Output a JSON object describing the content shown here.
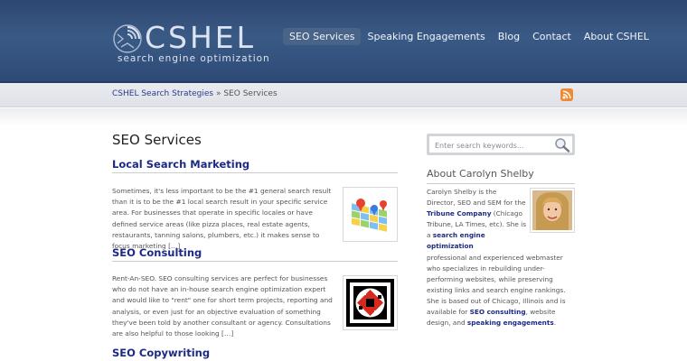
{
  "header": {
    "logo_text": "CSHEL",
    "logo_tagline": "search engine optimization",
    "nav": [
      {
        "label": "SEO Services",
        "active": true
      },
      {
        "label": "Speaking Engagements",
        "active": false
      },
      {
        "label": "Blog",
        "active": false
      },
      {
        "label": "Contact",
        "active": false
      },
      {
        "label": "About CSHEL",
        "active": false
      }
    ]
  },
  "breadcrumb": {
    "home": "CSHEL Search Strategies",
    "separator": "»",
    "current": "SEO Services"
  },
  "main": {
    "page_title": "SEO Services",
    "posts": [
      {
        "title": "Local Search Marketing",
        "excerpt": "Sometimes, it's less important to be the #1 general search result than it is to be the #1 local search result in your specific service area. For businesses that operate in specific locales or have defined service areas (like pizza places, real estate agents, restaurants, tanning salons, plumbers, etc.) it makes sense to focus marketing […]",
        "thumb_icon": "map-pins-icon"
      },
      {
        "title": "SEO Consulting",
        "excerpt": "Rent-An-SEO. SEO consulting services are perfect for businesses who do not have an in-house search engine optimization expert and would like to \"rent\" one for short term projects, reporting and analysis, or even just for an objective evaluation of something they've been told by another consultant or agency. Consultations are also helpful to those looking […]",
        "thumb_icon": "qr-code-icon"
      },
      {
        "title": "SEO Copywriting"
      }
    ]
  },
  "sidebar": {
    "search_placeholder": "Enter search keywords...",
    "about_title": "About Carolyn Shelby",
    "bio": {
      "t1": "Carolyn Shelby is the Director, SEO and SEM for the ",
      "l1": "Tribune Company",
      "t2": " (Chicago Tribune, LA Times, etc). She is a ",
      "l2": "search engine optimization",
      "t3": " professional and experienced webmaster who specializes in rebuilding under-performing websites, while preserving existing links and search engine rankings. She is based out of Chicago, Illinois and is available for ",
      "l3": "SEO consulting",
      "t4": ", website design, and ",
      "l4": "speaking engagements",
      "t5": "."
    }
  },
  "colors": {
    "header_bg": "#34517d",
    "link": "#1c2a86",
    "rss": "#f08a3a"
  }
}
